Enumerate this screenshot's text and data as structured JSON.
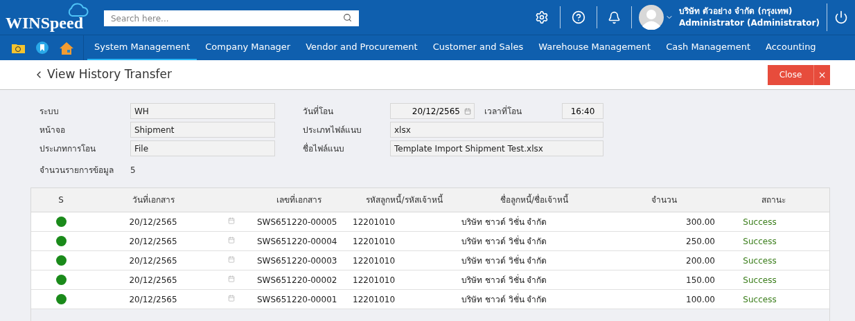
{
  "header": {
    "logo": "WINSpeed",
    "search": {
      "placeholder": "Search here..."
    },
    "user": {
      "company": "บริษัท ตัวอย่าง จำกัด (กรุงเทพ)",
      "name": "Administrator (Administrator)"
    }
  },
  "menu": [
    {
      "label": "System Management",
      "selected": true
    },
    {
      "label": "Company Manager",
      "selected": false
    },
    {
      "label": "Vendor and Procurement",
      "selected": false
    },
    {
      "label": "Customer and Sales",
      "selected": false
    },
    {
      "label": "Warehouse Management",
      "selected": false
    },
    {
      "label": "Cash Management",
      "selected": false
    },
    {
      "label": "Accounting",
      "selected": false
    }
  ],
  "page": {
    "title": "View History Transfer",
    "close": "Close",
    "close_x": "×"
  },
  "form": {
    "system_label": "ระบบ",
    "system": "WH",
    "screen_label": "หน้าจอ",
    "screen": "Shipment",
    "transfer_type_label": "ประเภทการโอน",
    "transfer_type": "File",
    "count_label": "จำนวนรายการข้อมูล",
    "count": "5",
    "date_label": "วันที่โอน",
    "date": "20/12/2565",
    "time_label": "เวลาที่โอน",
    "time": "16:40",
    "file_type_label": "ประเภทไฟล์แนบ",
    "file_type": "xlsx",
    "file_name_label": "ชื่อไฟล์แนบ",
    "file_name": "Template Import Shipment Test.xlsx"
  },
  "table": {
    "columns": [
      "S",
      "วันที่เอกสาร",
      "เลขที่เอกสาร",
      "รหัสลูกหนี้/รหัสเจ้าหนี้",
      "ชื่อลูกหนี้/ชื่อเจ้าหนี้",
      "จำนวน",
      "สถานะ"
    ],
    "rows": [
      {
        "color": "#1a8a1a",
        "date": "20/12/2565",
        "doc_no": "SWS651220-00005",
        "code": "12201010",
        "name": "บริษัท ชาวด์ วิชั่น จำกัด",
        "amount": "300.00",
        "status": "Success"
      },
      {
        "color": "#1a8a1a",
        "date": "20/12/2565",
        "doc_no": "SWS651220-00004",
        "code": "12201010",
        "name": "บริษัท ชาวด์ วิชั่น จำกัด",
        "amount": "250.00",
        "status": "Success"
      },
      {
        "color": "#1a8a1a",
        "date": "20/12/2565",
        "doc_no": "SWS651220-00003",
        "code": "12201010",
        "name": "บริษัท ชาวด์ วิชั่น จำกัด",
        "amount": "200.00",
        "status": "Success"
      },
      {
        "color": "#1a8a1a",
        "date": "20/12/2565",
        "doc_no": "SWS651220-00002",
        "code": "12201010",
        "name": "บริษัท ชาวด์ วิชั่น จำกัด",
        "amount": "150.00",
        "status": "Success"
      },
      {
        "color": "#1a8a1a",
        "date": "20/12/2565",
        "doc_no": "SWS651220-00001",
        "code": "12201010",
        "name": "บริษัท ชาวด์ วิชั่น จำกัด",
        "amount": "100.00",
        "status": "Success"
      }
    ]
  }
}
